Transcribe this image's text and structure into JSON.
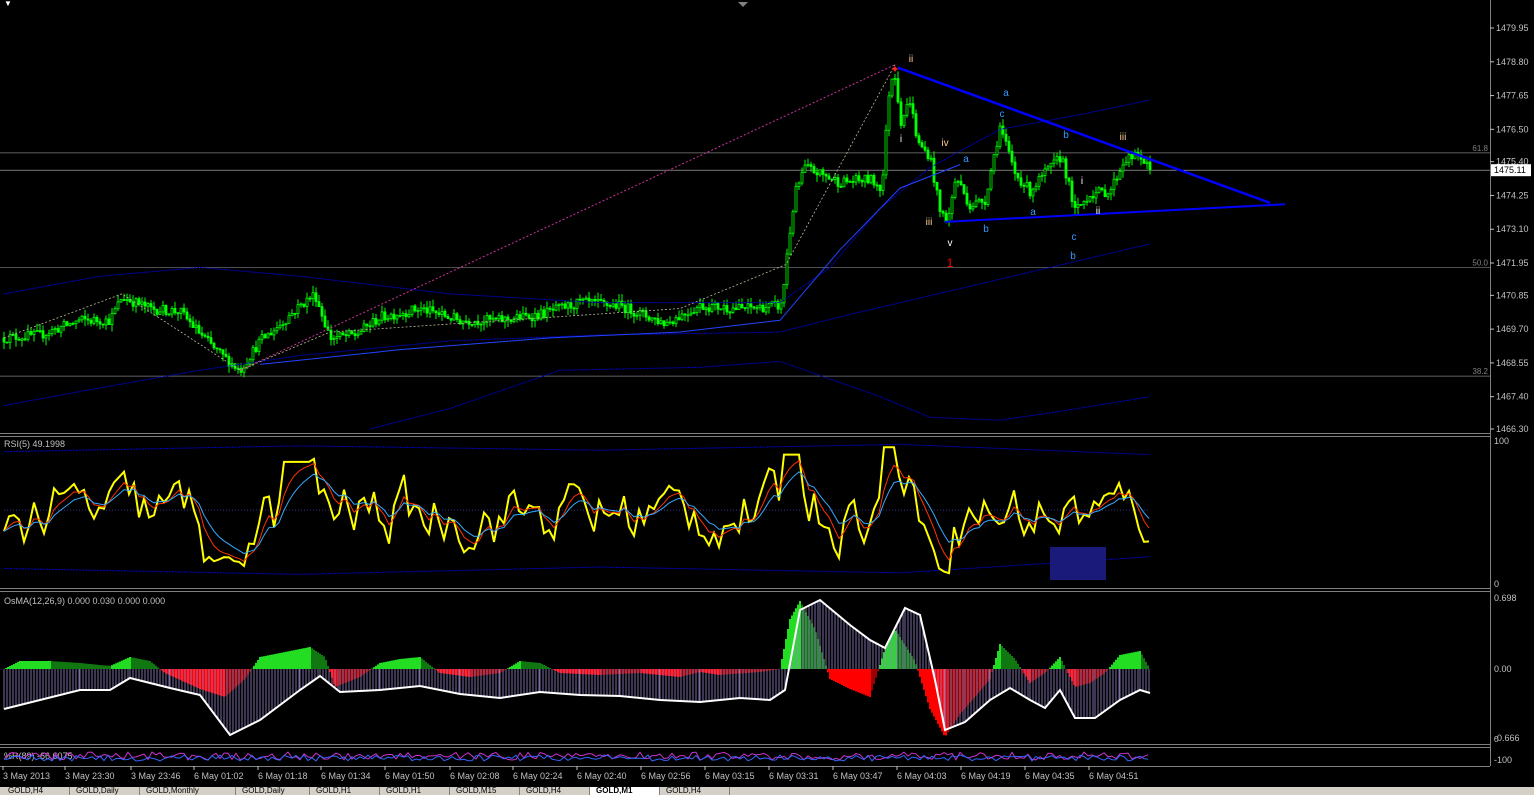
{
  "symbol_marker": "▼",
  "main": {
    "price_labels": [
      "1479.95",
      "1478.80",
      "1477.65",
      "1476.50",
      "1475.40",
      "1474.25",
      "1473.10",
      "1471.95",
      "1470.85",
      "1469.70",
      "1468.55",
      "1467.40",
      "1466.30"
    ],
    "current_price": "1475.11",
    "fib_levels": [
      {
        "label": "61.8",
        "price": "1475.70"
      },
      {
        "label": "50.0",
        "price": "1471.80"
      },
      {
        "label": "38.2",
        "price": "1468.10"
      }
    ],
    "wave_labels": [
      {
        "text": "ii",
        "color": "#ffcc99"
      },
      {
        "text": "i",
        "color": "#ffffff"
      },
      {
        "text": "iv",
        "color": "#ffcc99"
      },
      {
        "text": "iii",
        "color": "#ffcc99"
      },
      {
        "text": "v",
        "color": "#ffffff"
      },
      {
        "text": "1",
        "color": "#ff0000"
      },
      {
        "text": "a",
        "color": "#3399ff"
      },
      {
        "text": "a",
        "color": "#3399ff"
      },
      {
        "text": "c",
        "color": "#3399ff"
      },
      {
        "text": "b",
        "color": "#3399ff"
      },
      {
        "text": "a",
        "color": "#3399ff"
      },
      {
        "text": "b",
        "color": "#3399ff"
      },
      {
        "text": "c",
        "color": "#3399ff"
      },
      {
        "text": "b",
        "color": "#3399ff"
      },
      {
        "text": "i",
        "color": "#ffffff"
      },
      {
        "text": "ii",
        "color": "#ffffff"
      },
      {
        "text": "iii",
        "color": "#ffcc99"
      }
    ]
  },
  "rsi": {
    "label": "RSI(5) 49.1998",
    "max": "100",
    "min": "0"
  },
  "osma": {
    "label": "OsMA(12,26,9) 0.000 0.030 0.000 0.000",
    "top": "0.698",
    "mid": "0.00",
    "bottom": "-0.666"
  },
  "wpr": {
    "label": "%R(89) -66.6075",
    "top": "0",
    "bottom": "-100"
  },
  "time_labels": [
    "3 May 2013",
    "3 May 23:30",
    "3 May 23:46",
    "6 May 01:02",
    "6 May 01:18",
    "6 May 01:34",
    "6 May 01:50",
    "6 May 02:08",
    "6 May 02:24",
    "6 May 02:40",
    "6 May 02:56",
    "6 May 03:15",
    "6 May 03:31",
    "6 May 03:47",
    "6 May 04:03",
    "6 May 04:19",
    "6 May 04:35",
    "6 May 04:51"
  ],
  "tabs": [
    {
      "label": "GOLD,H4",
      "active": false
    },
    {
      "label": "GOLD,Daily",
      "active": false
    },
    {
      "label": "GOLD,Monthly",
      "active": false
    },
    {
      "label": "GOLD,Daily",
      "active": false
    },
    {
      "label": "GOLD,H1",
      "active": false
    },
    {
      "label": "GOLD,H1",
      "active": false
    },
    {
      "label": "GOLD,M15",
      "active": false
    },
    {
      "label": "GOLD,H4",
      "active": false
    },
    {
      "label": "GOLD,M1",
      "active": true
    },
    {
      "label": "GOLD,H4",
      "active": false
    }
  ],
  "colors": {
    "background": "#000000",
    "candle": "#00ff00",
    "trendline": "#0000ff",
    "envelope": "#0000cc",
    "rsi_line": "#ffff00",
    "osma_pos": "#22dd22",
    "osma_neg": "#ff0000",
    "osma_signal": "#ffffff",
    "grid_label": "#c0c0c0"
  }
}
